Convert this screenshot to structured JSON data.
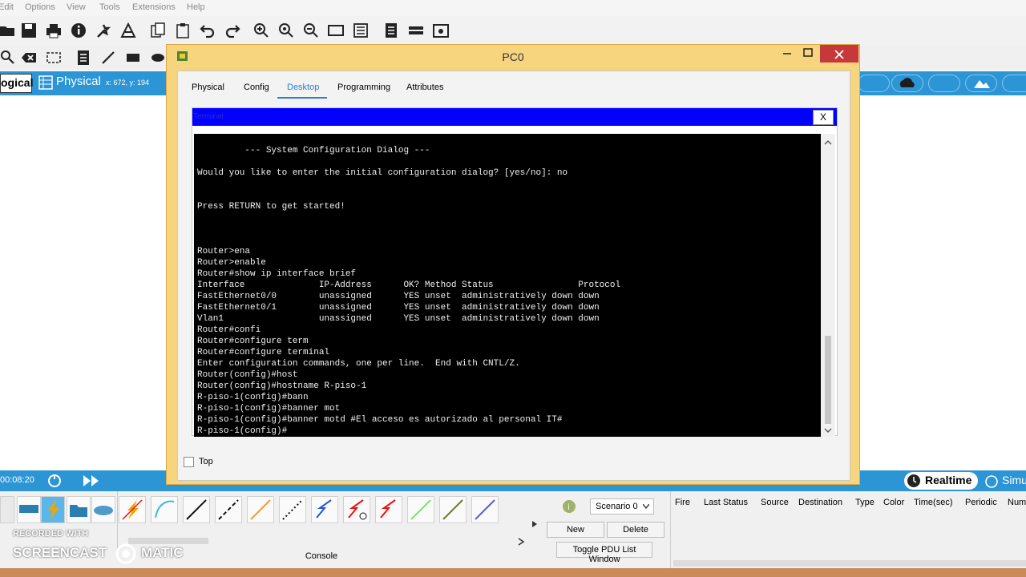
{
  "menu": [
    "Edit",
    "Options",
    "View",
    "Tools",
    "Extensions",
    "Help"
  ],
  "strip": {
    "logical": "ogical",
    "physical": "Physical",
    "coords": "x: 672, y: 194"
  },
  "sim": {
    "time": "00:08:20",
    "realtime": "Realtime",
    "simulation": "Simu"
  },
  "console_label": "Console",
  "watermark": {
    "line1": "RECORDED WITH",
    "line2": "SCREENCAST",
    "line3": "MATIC"
  },
  "pdu": {
    "scenario": "Scenario 0",
    "new": "New",
    "delete": "Delete",
    "toggle": "Toggle PDU List Window",
    "columns": [
      "Fire",
      "Last Status",
      "Source",
      "Destination",
      "Type",
      "Color",
      "Time(sec)",
      "Periodic",
      "Num"
    ]
  },
  "window": {
    "title": "PC0",
    "tabs": [
      "Physical",
      "Config",
      "Desktop",
      "Programming",
      "Attributes"
    ],
    "active_tab": "Desktop",
    "terminal_title": "Terminal",
    "close_label": "X",
    "top_label": "Top"
  },
  "terminal_lines": [
    "",
    "         --- System Configuration Dialog ---",
    "",
    "Would you like to enter the initial configuration dialog? [yes/no]: no",
    "",
    "",
    "Press RETURN to get started!",
    "",
    "",
    "",
    "Router>ena",
    "Router>enable",
    "Router#show ip interface brief",
    "Interface              IP-Address      OK? Method Status                Protocol",
    "FastEthernet0/0        unassigned      YES unset  administratively down down",
    "FastEthernet0/1        unassigned      YES unset  administratively down down",
    "Vlan1                  unassigned      YES unset  administratively down down",
    "Router#confi",
    "Router#configure term",
    "Router#configure terminal",
    "Enter configuration commands, one per line.  End with CNTL/Z.",
    "Router(config)#host",
    "Router(config)#hostname R-piso-1",
    "R-piso-1(config)#bann",
    "R-piso-1(config)#banner mot",
    "R-piso-1(config)#banner motd #El acceso es autorizado al personal IT#",
    "R-piso-1(config)#"
  ]
}
